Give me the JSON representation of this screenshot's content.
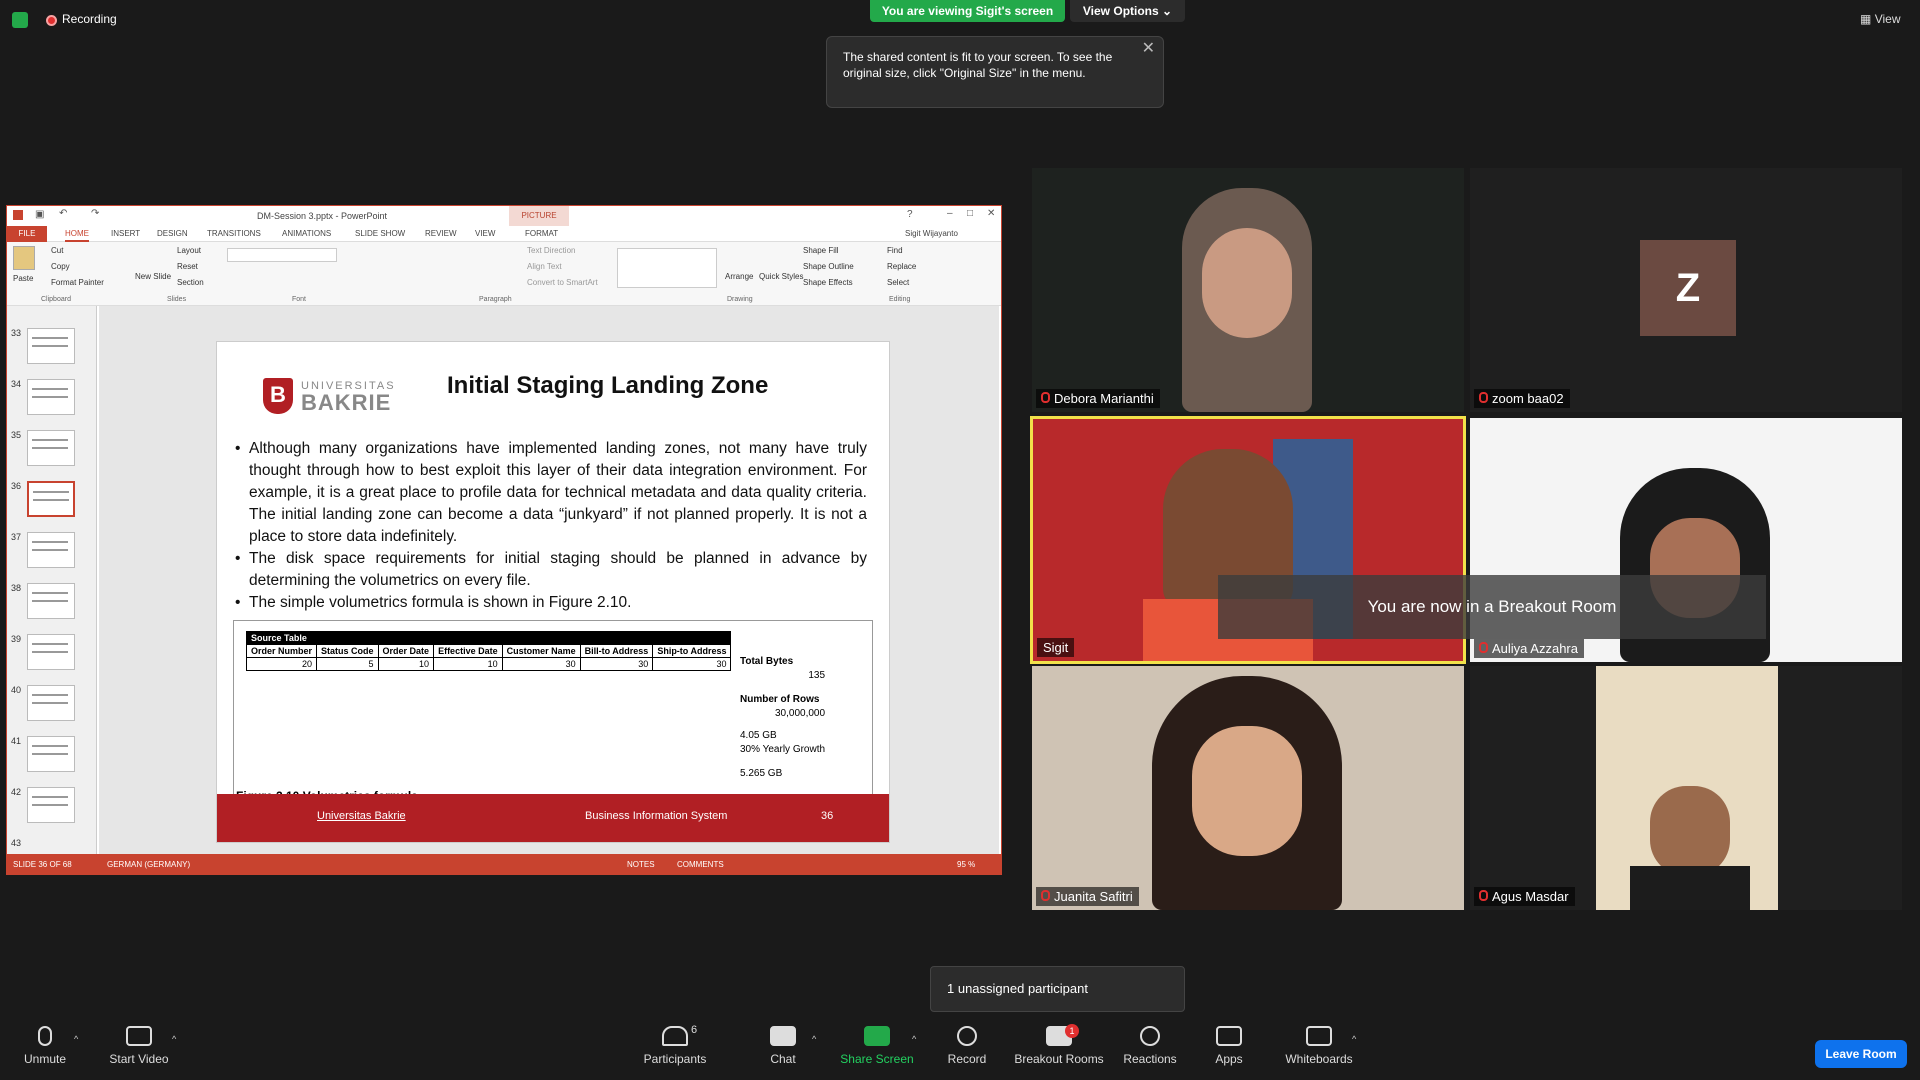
{
  "top": {
    "recording_label": "Recording",
    "viewing_badge": "You are viewing Sigit's screen",
    "view_options": "View Options",
    "view_label": "View",
    "tooltip": "The shared content is fit to your screen. To see the original size, click \"Original Size\" in the menu."
  },
  "ppt": {
    "window_title": "DM-Session 3.pptx - PowerPoint",
    "picture_tools": "PICTURE TOOLS",
    "user": "Sigit Wijayanto",
    "tabs": [
      "FILE",
      "HOME",
      "INSERT",
      "DESIGN",
      "TRANSITIONS",
      "ANIMATIONS",
      "SLIDE SHOW",
      "REVIEW",
      "VIEW",
      "FORMAT"
    ],
    "ribbon": {
      "paste": "Paste",
      "cut": "Cut",
      "copy": "Copy",
      "format_painter": "Format Painter",
      "clipboard": "Clipboard",
      "new_slide": "New Slide",
      "layout": "Layout",
      "reset": "Reset",
      "section": "Section",
      "slides": "Slides",
      "font": "Font",
      "paragraph": "Paragraph",
      "text_direction": "Text Direction",
      "align_text": "Align Text",
      "convert_smartart": "Convert to SmartArt",
      "arrange": "Arrange",
      "quick_styles": "Quick Styles",
      "shape_fill": "Shape Fill",
      "shape_outline": "Shape Outline",
      "shape_effects": "Shape Effects",
      "drawing": "Drawing",
      "find": "Find",
      "replace": "Replace",
      "select": "Select",
      "editing": "Editing"
    },
    "thumb_numbers": [
      "33",
      "34",
      "35",
      "36",
      "37",
      "38",
      "39",
      "40",
      "41",
      "42",
      "43"
    ],
    "slide": {
      "logo_top": "UNIVERSITAS",
      "logo_main": "BAKRIE",
      "logo_mark": "B",
      "title": "Initial Staging Landing Zone",
      "bullets": [
        "Although many organizations have implemented landing zones, not many have truly thought through how to best exploit this layer of their data integration environment. For example, it is a great place to profile data for technical metadata and data quality criteria. The initial landing zone can become a data “junkyard” if not planned properly. It is not a place to store data indefinitely.",
        "The disk space requirements for initial staging should be planned in advance by determining the volumetrics on every file.",
        "The simple volumetrics formula is shown in Figure 2.10."
      ],
      "figure": {
        "table_title": "Source Table",
        "columns": [
          "Order Number",
          "Status Code",
          "Order Date",
          "Effective Date",
          "Customer Name",
          "Bill-to Address",
          "Ship-to Address"
        ],
        "values": [
          "20",
          "5",
          "10",
          "10",
          "30",
          "30",
          "30"
        ],
        "total_bytes_label": "Total Bytes",
        "total_bytes": "135",
        "rows_label": "Number of Rows",
        "rows": "30,000,000",
        "size": "4.05 GB",
        "growth": "30% Yearly Growth",
        "projected": "5.265 GB",
        "caption": "Figure 2.10     Volumetrics formula"
      },
      "footer_left": "Universitas Bakrie",
      "footer_mid": "Business Information System",
      "footer_page": "36"
    },
    "status": {
      "slide_of": "SLIDE 36 OF 68",
      "language": "GERMAN (GERMANY)",
      "notes": "NOTES",
      "comments": "COMMENTS",
      "zoom": "95 %"
    }
  },
  "participants": [
    {
      "name": "Debora Marianthi"
    },
    {
      "name": "zoom baa02",
      "avatar": "Z"
    },
    {
      "name": "Sigit"
    },
    {
      "name": "Auliya Azzahra"
    },
    {
      "name": "Juanita Safitri"
    },
    {
      "name": "Agus Masdar"
    }
  ],
  "breakout_banner": "You are now in a Breakout Room",
  "unassigned": "1 unassigned participant",
  "toolbar": {
    "unmute": "Unmute",
    "start_video": "Start Video",
    "participants": "Participants",
    "participants_count": "6",
    "chat": "Chat",
    "share_screen": "Share Screen",
    "record": "Record",
    "breakout_rooms": "Breakout Rooms",
    "breakout_badge": "1",
    "reactions": "Reactions",
    "apps": "Apps",
    "whiteboards": "Whiteboards",
    "leave_room": "Leave Room"
  },
  "colors": {
    "zoom_green": "#23a94a",
    "ppt_accent": "#c8432f",
    "bakrie_red": "#b11f24",
    "leave_blue": "#0e72ed",
    "avatar_brown": "#6b4a41",
    "speaker_border": "#f2e14a"
  }
}
